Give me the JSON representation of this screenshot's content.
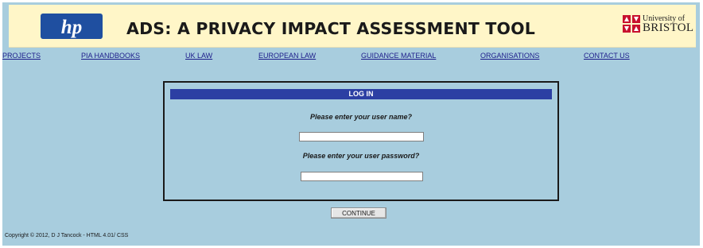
{
  "header": {
    "hp_logo_text": "hp",
    "title": "ADS: A PRIVACY IMPACT ASSESSMENT TOOL",
    "university_line1": "University of",
    "university_line2": "BRISTOL"
  },
  "nav": [
    {
      "label": "PROJECTS"
    },
    {
      "label": "PIA HANDBOOKS"
    },
    {
      "label": "UK LAW"
    },
    {
      "label": "EUROPEAN LAW"
    },
    {
      "label": "GUIDANCE MATERIAL"
    },
    {
      "label": "ORGANISATIONS"
    },
    {
      "label": "CONTACT US"
    }
  ],
  "login": {
    "heading": "LOG IN",
    "username_prompt": "Please enter your user name?",
    "username_value": "",
    "password_prompt": "Please enter your user password?",
    "password_value": ""
  },
  "continue_label": "CONTINUE",
  "footer": "Copyright © 2012, D J Tancock - HTML 4.01/ CSS",
  "colors": {
    "page_background": "#a8cdde",
    "banner_background": "#fff6c8",
    "login_header": "#2c3fa3",
    "link": "#1d1d8a",
    "hp_blue": "#1f4fa0",
    "bristol_red": "#c8102e"
  }
}
